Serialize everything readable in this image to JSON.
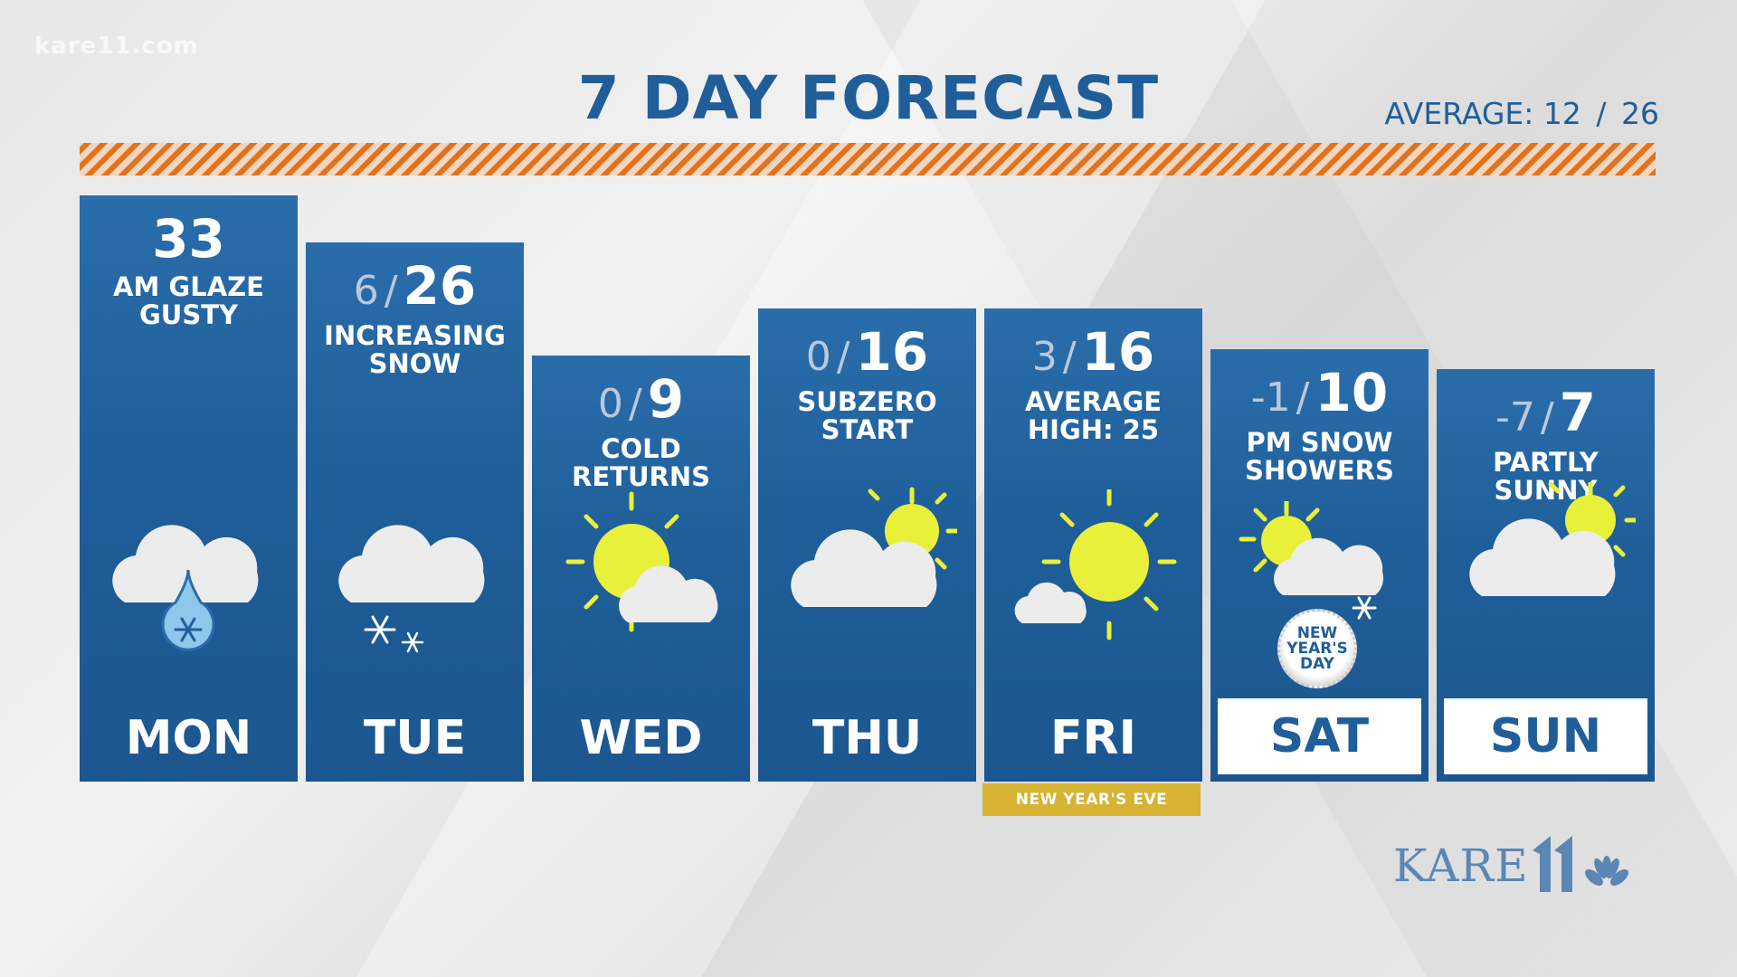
{
  "watermark": "kare11.com",
  "title": "7 DAY FORECAST",
  "average": {
    "label": "AVERAGE:",
    "low": "12",
    "high": "26"
  },
  "days": [
    {
      "day": "MON",
      "low": "",
      "high": "33",
      "condition_line1": "AM GLAZE",
      "condition_line2": "GUSTY",
      "icon": "cloud-freezing-rain-icon"
    },
    {
      "day": "TUE",
      "low": "6",
      "high": "26",
      "condition_line1": "INCREASING",
      "condition_line2": "SNOW",
      "icon": "cloud-snow-icon"
    },
    {
      "day": "WED",
      "low": "0",
      "high": "9",
      "condition_line1": "COLD",
      "condition_line2": "RETURNS",
      "icon": "mostly-sunny-icon"
    },
    {
      "day": "THU",
      "low": "0",
      "high": "16",
      "condition_line1": "SUBZERO",
      "condition_line2": "START",
      "icon": "partly-cloudy-icon"
    },
    {
      "day": "FRI",
      "low": "3",
      "high": "16",
      "condition_line1": "AVERAGE",
      "condition_line2": "HIGH: 25",
      "icon": "sunny-icon"
    },
    {
      "day": "SAT",
      "low": "-1",
      "high": "10",
      "condition_line1": "PM SNOW",
      "condition_line2": "SHOWERS",
      "icon": "snow-showers-icon"
    },
    {
      "day": "SUN",
      "low": "-7",
      "high": "7",
      "condition_line1": "PARTLY",
      "condition_line2": "SUNNY",
      "icon": "partly-cloudy-icon"
    }
  ],
  "fri_banner": "NEW YEAR'S EVE",
  "sat_badge": {
    "line1": "NEW",
    "line2": "YEAR'S",
    "line3": "DAY"
  },
  "logo": "KARE",
  "colors": {
    "brand_blue": "#1f5e99",
    "stripe_orange": "#e2731e",
    "sun_yellow": "#e8f03a",
    "banner_gold": "#d6b332"
  }
}
